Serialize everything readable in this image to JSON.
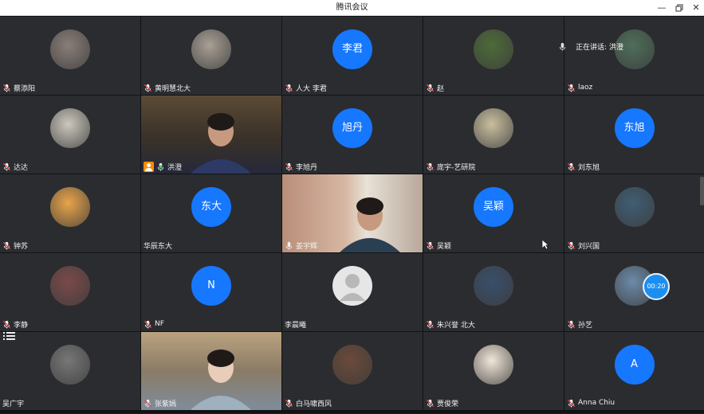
{
  "window": {
    "title": "腾讯会议",
    "minimize_icon": "minimize-icon",
    "restore_icon": "restore-icon",
    "close_icon": "close-icon"
  },
  "speaking_indicator": {
    "text": "正在讲话: 洪澄",
    "icon": "mic-icon"
  },
  "timer": "00:20",
  "colors": {
    "initials_bg": "#1677ff",
    "tile_bg": "#2b2c30",
    "host_badge": "#ff8a00"
  },
  "participants": [
    {
      "name": "蔡添阳",
      "avatar": "photo",
      "mic": "muted"
    },
    {
      "name": "黄明慧北大",
      "avatar": "photo",
      "mic": "muted"
    },
    {
      "name": "人大 李君",
      "avatar": "initials",
      "initials": "李君",
      "mic": "muted"
    },
    {
      "name": "赵",
      "avatar": "photo",
      "mic": "muted"
    },
    {
      "name": "laoz",
      "avatar": "photo",
      "mic": "muted"
    },
    {
      "name": "达达",
      "avatar": "photo",
      "mic": "muted"
    },
    {
      "name": "洪澄",
      "avatar": "video",
      "mic": "active",
      "host": true
    },
    {
      "name": "李旭丹",
      "avatar": "initials",
      "initials": "旭丹",
      "mic": "muted"
    },
    {
      "name": "庞宇-艺研院",
      "avatar": "photo",
      "mic": "muted"
    },
    {
      "name": "刘东旭",
      "avatar": "initials",
      "initials": "东旭",
      "mic": "muted"
    },
    {
      "name": "钟苏",
      "avatar": "photo",
      "mic": "muted"
    },
    {
      "name": "华辰东大",
      "avatar": "initials",
      "initials": "东大",
      "mic": "none"
    },
    {
      "name": "姜宇辉",
      "avatar": "video",
      "mic": "on"
    },
    {
      "name": "吴颖",
      "avatar": "initials",
      "initials": "吴颖",
      "mic": "muted"
    },
    {
      "name": "刘兴国",
      "avatar": "photo",
      "mic": "muted"
    },
    {
      "name": "李静",
      "avatar": "photo",
      "mic": "muted"
    },
    {
      "name": "NF",
      "avatar": "initials",
      "initials": "N",
      "mic": "muted"
    },
    {
      "name": "李晨曦",
      "avatar": "default",
      "mic": "none"
    },
    {
      "name": "朱兴誉 北大",
      "avatar": "photo",
      "mic": "muted"
    },
    {
      "name": "孙艺",
      "avatar": "photo",
      "mic": "muted"
    },
    {
      "name": "吴广宇",
      "avatar": "photo",
      "mic": "none"
    },
    {
      "name": "张紫嫣",
      "avatar": "video",
      "mic": "muted"
    },
    {
      "name": "白马啸西风",
      "avatar": "photo",
      "mic": "muted"
    },
    {
      "name": "贾俊荣",
      "avatar": "photo",
      "mic": "muted"
    },
    {
      "name": "Anna Chiu",
      "avatar": "initials",
      "initials": "A",
      "mic": "muted"
    }
  ]
}
